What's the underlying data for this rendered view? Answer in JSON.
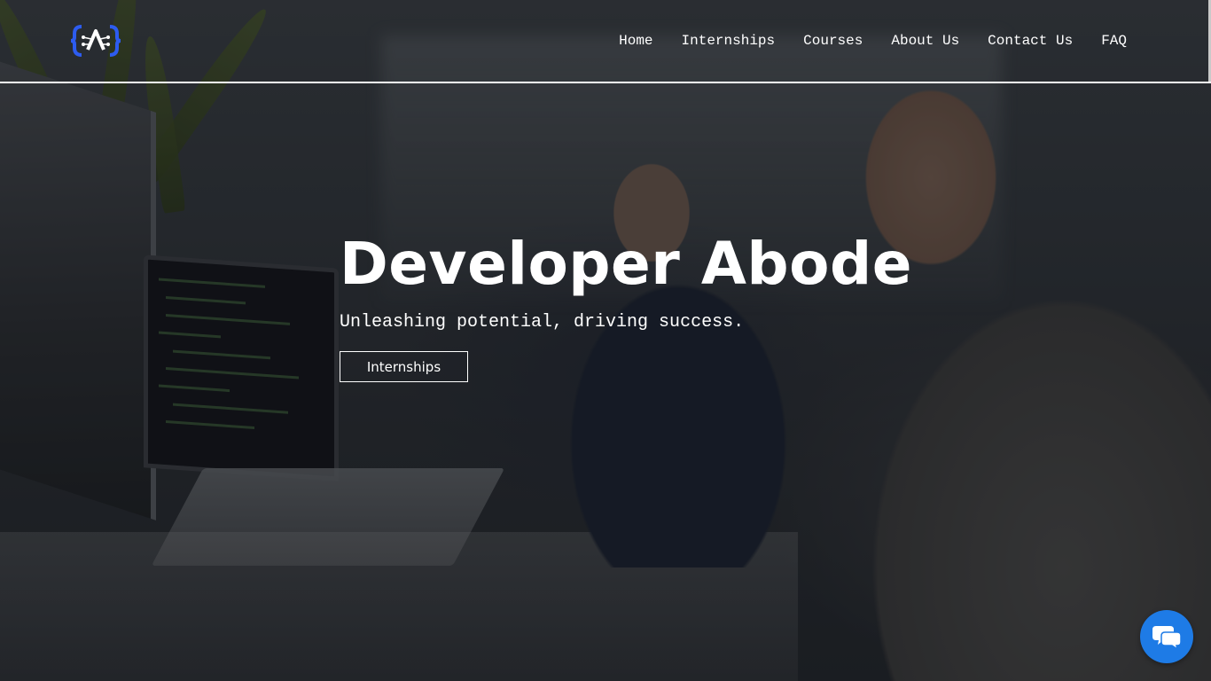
{
  "site": {
    "logo_icon": "developer-abode-logo",
    "brand_color": "#2d5cf0"
  },
  "nav": {
    "items": [
      {
        "label": "Home"
      },
      {
        "label": "Internships"
      },
      {
        "label": "Courses"
      },
      {
        "label": "About Us"
      },
      {
        "label": "Contact Us"
      },
      {
        "label": "FAQ"
      }
    ]
  },
  "hero": {
    "title": "Developer Abode",
    "subtitle": "Unleashing potential, driving success.",
    "button_label": "Internships",
    "background_description_icon": "office-photo-background"
  },
  "chat": {
    "icon": "chat-bubbles-icon",
    "color": "#1e7be6"
  }
}
